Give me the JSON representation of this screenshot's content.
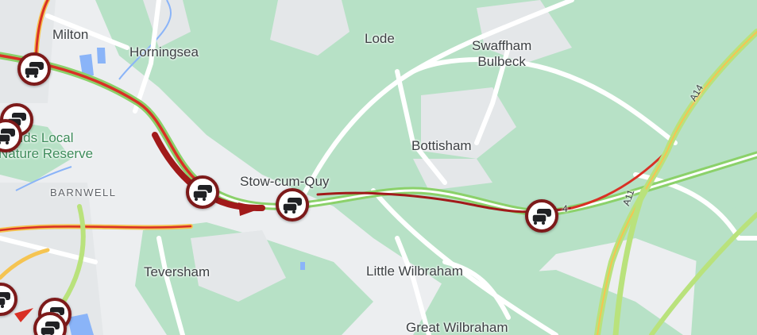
{
  "map": {
    "places": [
      {
        "id": "milton",
        "label": "Milton"
      },
      {
        "id": "horningsea",
        "label": "Horningsea"
      },
      {
        "id": "lode",
        "label": "Lode"
      },
      {
        "id": "swaffham-bulbeck",
        "label": "Swaffham\nBulbeck"
      },
      {
        "id": "bottisham",
        "label": "Bottisham"
      },
      {
        "id": "stow-cum-quy",
        "label": "Stow-cum-Quy"
      },
      {
        "id": "barnwell",
        "label": "BARNWELL"
      },
      {
        "id": "teversham",
        "label": "Teversham"
      },
      {
        "id": "little-wilbraham",
        "label": "Little Wilbraham"
      },
      {
        "id": "great-wilbraham",
        "label": "Great Wilbraham"
      },
      {
        "id": "nature-reserve",
        "label": "efields Local\nNature Reserve"
      }
    ],
    "road_labels": [
      {
        "id": "a14",
        "label": "A14"
      },
      {
        "id": "a11",
        "label": "A11"
      },
      {
        "id": "a14-partial",
        "label": "4"
      }
    ],
    "incident_icon": "traffic-jam-icon",
    "colors": {
      "green_area": "#b7e1c6",
      "land": "#eceef0",
      "road": "#ffffff",
      "traffic_green": "#8bd16a",
      "traffic_yellow": "#f5c451",
      "traffic_red": "#d93025",
      "traffic_darkred": "#a11a1a",
      "jam_border": "#7d1a1a",
      "water": "#8ab4f8"
    }
  }
}
